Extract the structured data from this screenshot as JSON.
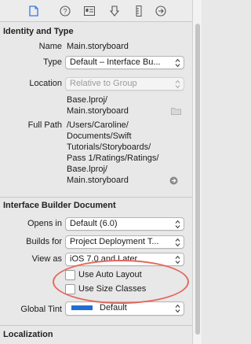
{
  "toolbar": {
    "icons": [
      "file-inspector-icon",
      "quick-help-icon",
      "identity-inspector-icon",
      "attributes-inspector-icon",
      "size-inspector-icon",
      "connections-inspector-icon"
    ]
  },
  "identity_and_type": {
    "header": "Identity and Type",
    "name_label": "Name",
    "name_value": "Main.storyboard",
    "type_label": "Type",
    "type_value": "Default – Interface Bu...",
    "location_label": "Location",
    "location_value": "Relative to Group",
    "location_path_line1": "Base.lproj/",
    "location_path_line2": "Main.storyboard",
    "full_path_label": "Full Path",
    "full_path_lines": [
      "/Users/Caroline/",
      "Documents/Swift",
      "Tutorials/Storyboards/",
      "Pass 1/Ratings/Ratings/",
      "Base.lproj/",
      "Main.storyboard"
    ]
  },
  "ib_document": {
    "header": "Interface Builder Document",
    "opens_in_label": "Opens in",
    "opens_in_value": "Default (6.0)",
    "builds_for_label": "Builds for",
    "builds_for_value": "Project Deployment T...",
    "view_as_label": "View as",
    "view_as_value": "iOS 7.0 and Later",
    "auto_layout_label": "Use Auto Layout",
    "auto_layout_checked": false,
    "size_classes_label": "Use Size Classes",
    "size_classes_checked": false,
    "global_tint_label": "Global Tint",
    "global_tint_value": "Default",
    "global_tint_color": "#1f6fd1"
  },
  "localization": {
    "header": "Localization"
  },
  "colors": {
    "highlight_oval": "#e4685d"
  }
}
